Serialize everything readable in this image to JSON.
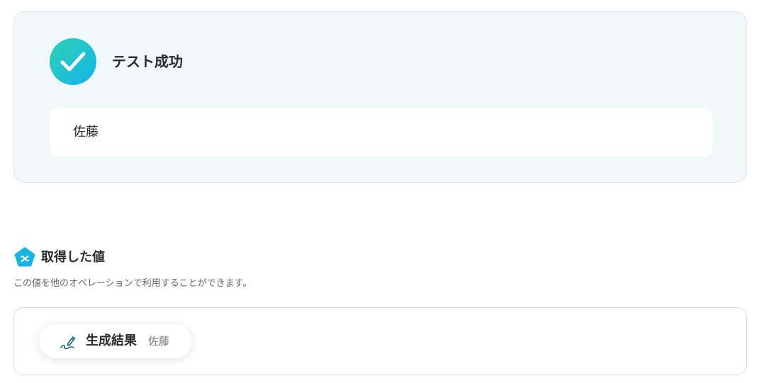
{
  "test_result": {
    "status_icon": "check-circle-icon",
    "title": "テスト成功",
    "output": "佐藤"
  },
  "retrieved_values": {
    "logo_icon": "pentagon-logo-icon",
    "title": "取得した値",
    "description": "この値を他のオペレーションで利用することができます。",
    "chips": [
      {
        "icon": "pen-signature-icon",
        "label": "生成結果",
        "value": "佐藤"
      }
    ]
  },
  "colors": {
    "success_panel_bg": "#f1f9f8",
    "accent_start": "#2ed3b4",
    "accent_end": "#14b3ea",
    "logo": "#18b4e6"
  }
}
